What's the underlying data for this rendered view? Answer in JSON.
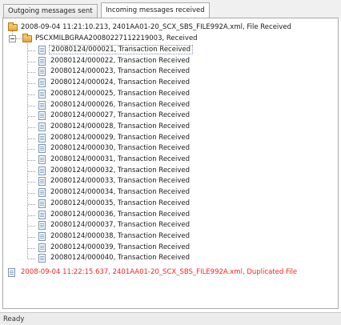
{
  "tabs": [
    {
      "label": "Outgoing messages sent",
      "active": false
    },
    {
      "label": "Incoming messages received",
      "active": true
    }
  ],
  "tree": {
    "root": {
      "label": "2008-09-04 11:21:10.213, 2401AA01-20_SCX_SBS_FILE992A.xml, File Received",
      "icon": "folder-open-icon"
    },
    "child": {
      "label": "PSCXMILBGRAA20080227112219003, Received",
      "icon": "folder-open-icon"
    },
    "transactions": [
      "20080124/000021, Transaction Received",
      "20080124/000022, Transaction Received",
      "20080124/000023, Transaction Received",
      "20080124/000024, Transaction Received",
      "20080124/000025, Transaction Received",
      "20080124/000026, Transaction Received",
      "20080124/000027, Transaction Received",
      "20080124/000028, Transaction Received",
      "20080124/000029, Transaction Received",
      "20080124/000030, Transaction Received",
      "20080124/000031, Transaction Received",
      "20080124/000032, Transaction Received",
      "20080124/000033, Transaction Received",
      "20080124/000034, Transaction Received",
      "20080124/000035, Transaction Received",
      "20080124/000036, Transaction Received",
      "20080124/000037, Transaction Received",
      "20080124/000038, Transaction Received",
      "20080124/000039, Transaction Received",
      "20080124/000040, Transaction Received"
    ],
    "selected_index": 0,
    "error_item": {
      "label": "2008-09-04 11:22:15.637, 2401AA01-20_SCX_SBS_FILE992A.xml, Duplicated File",
      "icon": "document-icon",
      "color": "#ff2020"
    }
  },
  "status": {
    "text": "Ready"
  }
}
